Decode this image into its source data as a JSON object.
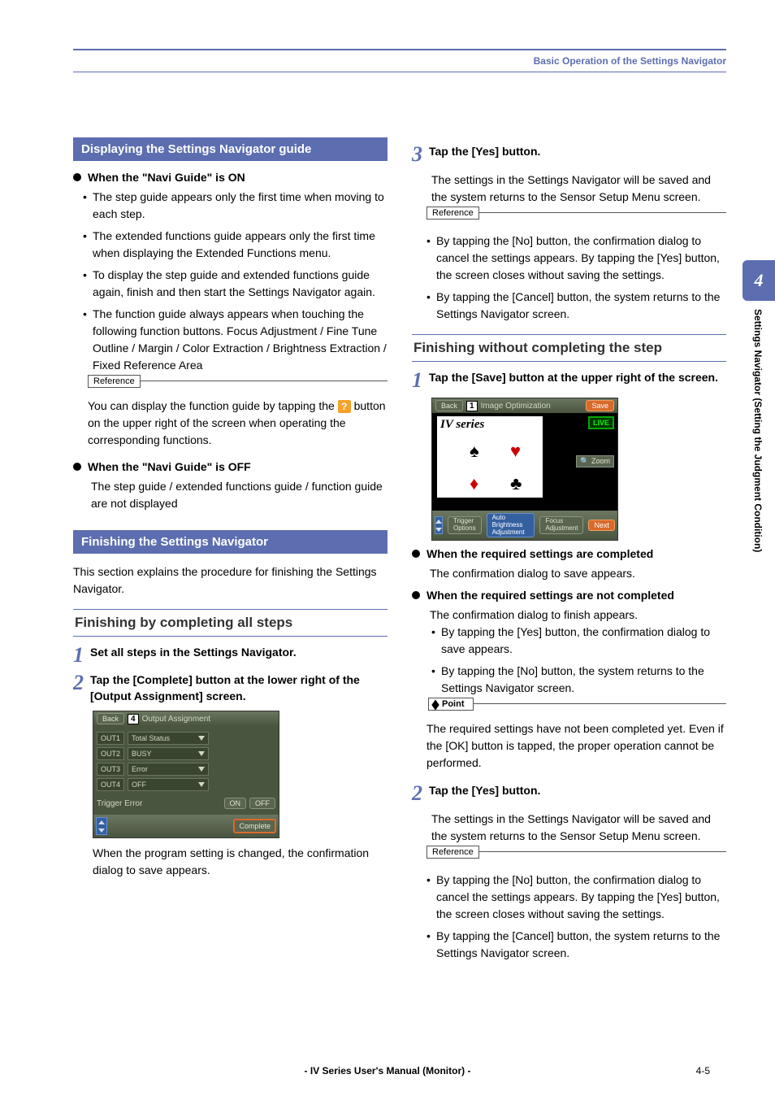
{
  "header": {
    "title": "Basic Operation of the Settings Navigator"
  },
  "sidetab": {
    "num": "4",
    "text": "Settings Navigator (Setting the Judgment Condition)"
  },
  "left": {
    "sec1_title": "Displaying the Settings Navigator guide",
    "navi_on": "When the \"Navi Guide\" is ON",
    "on_b1": "The step guide appears only the first time when moving to each step.",
    "on_b2": "The extended functions guide appears only the first time when displaying the Extended Functions  menu.",
    "on_b3": "To display the step guide and extended functions guide again, finish and then start the Settings Navigator again.",
    "on_b4": "The function guide always appears when touching the following function buttons. Focus Adjustment / Fine Tune Outline / Margin / Color Extraction / Brightness Extraction / Fixed Reference Area",
    "ref1_label": "Reference",
    "ref1_body1": "You can display the function guide by tapping the ",
    "ref1_body2": " button on the upper right of the screen when operating the corresponding functions.",
    "navi_off": "When the \"Navi Guide\" is OFF",
    "off_body": "The step guide / extended functions guide / function guide are not displayed",
    "sec2_title": "Finishing the Settings Navigator",
    "sec2_intro": "This section explains the procedure for finishing the Settings Navigator.",
    "sub_allsteps": "Finishing by completing all steps",
    "step1": "Set all steps in the Settings Navigator.",
    "step2": "Tap the [Complete] button at the lower right of the [Output Assignment] screen.",
    "ss1": {
      "back": "Back",
      "num": "4",
      "title": "Output Assignment",
      "out1": "OUT1",
      "out2": "OUT2",
      "out3": "OUT3",
      "out4": "OUT4",
      "v1": "Total Status",
      "v2": "BUSY",
      "v3": "Error",
      "v4": "OFF",
      "trigerr": "Trigger Error",
      "on": "ON",
      "off": "OFF",
      "complete": "Complete"
    },
    "step2_after": "When the program setting is changed, the confirmation dialog to save appears."
  },
  "right": {
    "step3": "Tap the [Yes] button.",
    "step3_body": "The settings in the Settings Navigator will be saved and the system returns to the Sensor Setup Menu screen.",
    "ref2_label": "Reference",
    "ref2_b1": "By tapping the [No] button, the confirmation dialog to cancel the settings appears. By tapping the [Yes] button, the screen closes without saving the settings.",
    "ref2_b2": "By tapping the [Cancel] button, the system returns to the Settings Navigator screen.",
    "sub_nocomplete": "Finishing without completing the step",
    "r_step1": "Tap the [Save] button at the upper right of the screen.",
    "ss2": {
      "back": "Back",
      "num": "1",
      "title": "Image Optimization",
      "save": "Save",
      "iv": "IV series",
      "live": "LIVE",
      "zoom": "🔍 Zoom",
      "trig": "Trigger Options",
      "auto": "Auto Brightness Adjustment",
      "focus": "Focus Adjustment",
      "next": "Next"
    },
    "req_done": "When the required settings are completed",
    "req_done_body": "The confirmation dialog to save appears.",
    "req_not": "When the required settings are not completed",
    "req_not_body": "The confirmation dialog to finish appears.",
    "req_not_b1": "By tapping the [Yes] button, the confirmation dialog to save appears.",
    "req_not_b2": "By tapping the [No] button, the system returns to the Settings Navigator screen.",
    "point_label": "Point",
    "point_body": "The required settings have not been completed yet. Even if the [OK] button is tapped, the proper operation cannot be performed.",
    "r_step2": "Tap the [Yes] button.",
    "r_step2_body": "The settings in the Settings Navigator will be saved and the system returns to the Sensor Setup Menu screen.",
    "ref3_label": "Reference",
    "ref3_b1": "By tapping the [No] button, the confirmation dialog to cancel the settings appears. By tapping the [Yes] button, the screen closes without saving the settings.",
    "ref3_b2": "By tapping the [Cancel] button, the system returns to the Settings Navigator screen."
  },
  "footer": {
    "text": "- IV Series User's Manual (Monitor) -",
    "page": "4-5"
  }
}
